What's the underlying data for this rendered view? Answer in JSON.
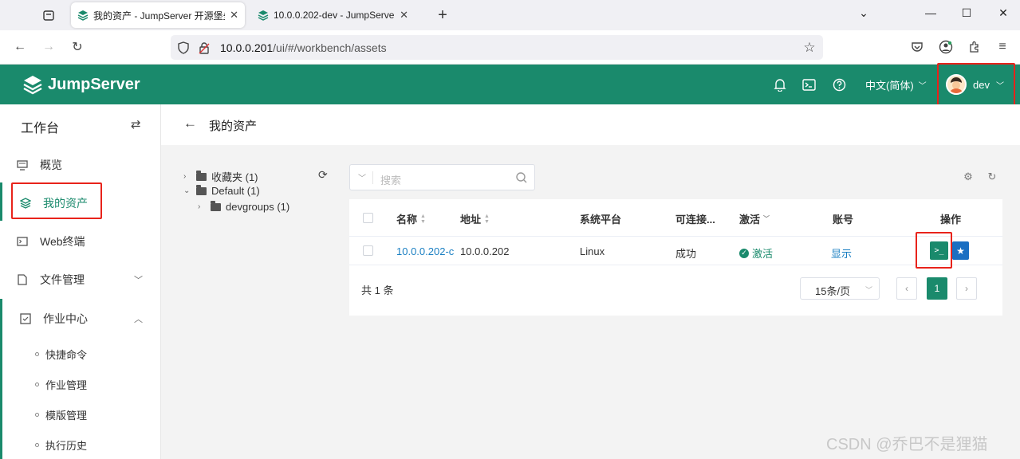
{
  "browser": {
    "tabs": [
      {
        "title": "我的资产 - JumpServer 开源堡垒机",
        "active": true
      },
      {
        "title": "10.0.0.202-dev - JumpServer",
        "active": false
      }
    ],
    "url_host": "10.0.0.201",
    "url_path": "/ui/#/workbench/assets"
  },
  "header": {
    "logo_text": "JumpServer",
    "language": "中文(简体)",
    "username": "dev"
  },
  "sidebar": {
    "title": "工作台",
    "items": [
      {
        "label": "概览",
        "icon": "monitor-icon"
      },
      {
        "label": "我的资产",
        "icon": "layers-icon",
        "active": true
      },
      {
        "label": "Web终端",
        "icon": "terminal-icon"
      },
      {
        "label": "文件管理",
        "icon": "file-icon"
      },
      {
        "label": "作业中心",
        "icon": "job-icon"
      }
    ],
    "sub_items": [
      "快捷命令",
      "作业管理",
      "模版管理",
      "执行历史"
    ]
  },
  "page": {
    "title": "我的资产"
  },
  "tree": [
    {
      "label": "收藏夹 (1)"
    },
    {
      "label": "Default (1)"
    },
    {
      "label": "devgroups (1)"
    }
  ],
  "search": {
    "placeholder": "搜索"
  },
  "table": {
    "columns": [
      "名称",
      "地址",
      "系统平台",
      "可连接...",
      "激活",
      "账号",
      "操作"
    ],
    "rows": [
      {
        "name": "10.0.0.202-c",
        "address": "10.0.0.202",
        "platform": "Linux",
        "connectivity": "成功",
        "active": "激活",
        "account": "显示"
      }
    ],
    "total": "共 1 条",
    "page_size": "15条/页",
    "current_page": "1"
  },
  "watermark": "CSDN @乔巴不是狸猫",
  "colors": {
    "brand": "#1a8a6c",
    "link": "#1a7fc2",
    "highlight": "#e8231b"
  }
}
